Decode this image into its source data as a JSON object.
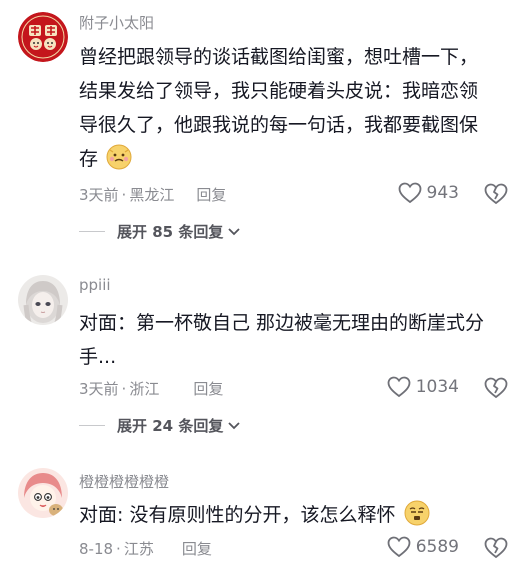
{
  "comments": [
    {
      "username": "附子小太阳",
      "text_lines": [
        "曾经把跟领导的谈话截图给闺蜜，想吐槽一下，",
        "结果发给了领导，我只能硬着头皮说：我暗恋领",
        "导很久了，他跟我说的每一句话，我都要截图保",
        "存"
      ],
      "time": "3天前",
      "location": "黑龙江",
      "reply_label": "回复",
      "likes": "943",
      "expand_label": "展开 85 条回复"
    },
    {
      "username": "ppiii",
      "text_lines": [
        "对面：第一杯敬自己 那边被毫无理由的断崖式分",
        "手..."
      ],
      "time": "3天前",
      "location": "浙江",
      "reply_label": "回复",
      "likes": "1034",
      "expand_label": "展开 24 条回复"
    },
    {
      "username": "橙橙橙橙橙橙",
      "text_lines": [
        "对面: 没有原则性的分开，该怎么释怀"
      ],
      "time": "8-18",
      "location": "江苏",
      "reply_label": "回复",
      "likes": "6589"
    }
  ],
  "meta_separator": "·",
  "icons": {
    "like": "heart-outline-icon",
    "dislike": "broken-heart-icon",
    "expand": "chevron-down-icon"
  },
  "colors": {
    "text": "#161823",
    "secondary": "#8a8b91",
    "avatar_red": "#c4161c"
  }
}
